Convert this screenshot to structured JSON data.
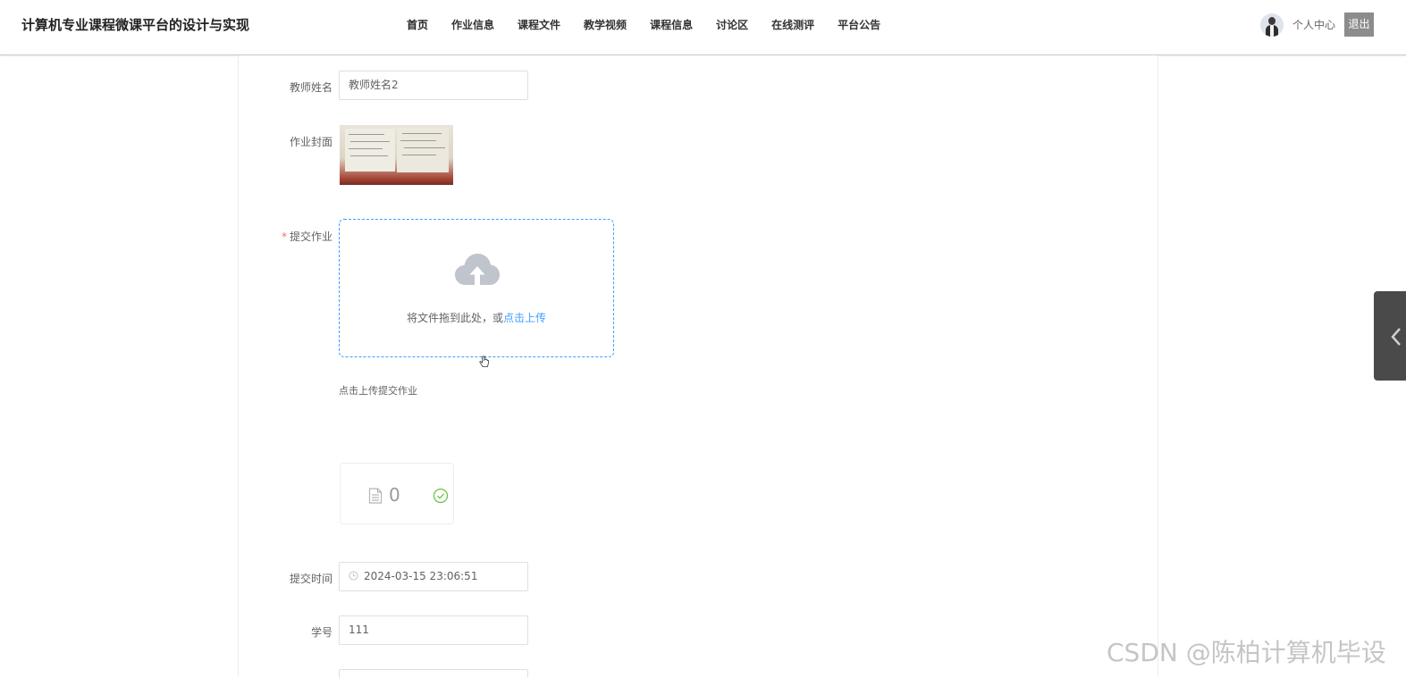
{
  "header": {
    "site_title": "计算机专业课程微课平台的设计与实现",
    "nav": [
      "首页",
      "作业信息",
      "课程文件",
      "教学视频",
      "课程信息",
      "讨论区",
      "在线测评",
      "平台公告"
    ],
    "user_center": "个人中心",
    "logout": "退出"
  },
  "form": {
    "teacher_name": {
      "label": "教师姓名",
      "value": "教师姓名2"
    },
    "cover": {
      "label": "作业封面"
    },
    "submit_homework": {
      "label": "提交作业",
      "required_mark": "*",
      "drag_text": "将文件拖到此处，或",
      "click_text": "点击上传",
      "tip": "点击上传提交作业",
      "file_count": "0"
    },
    "submit_time": {
      "label": "提交时间",
      "value": "2024-03-15 23:06:51"
    },
    "student_id": {
      "label": "学号",
      "value": "111"
    }
  },
  "watermark": "CSDN @陈柏计算机毕设",
  "colors": {
    "accent": "#409eff",
    "required": "#f56c6c",
    "success": "#67c23a"
  }
}
